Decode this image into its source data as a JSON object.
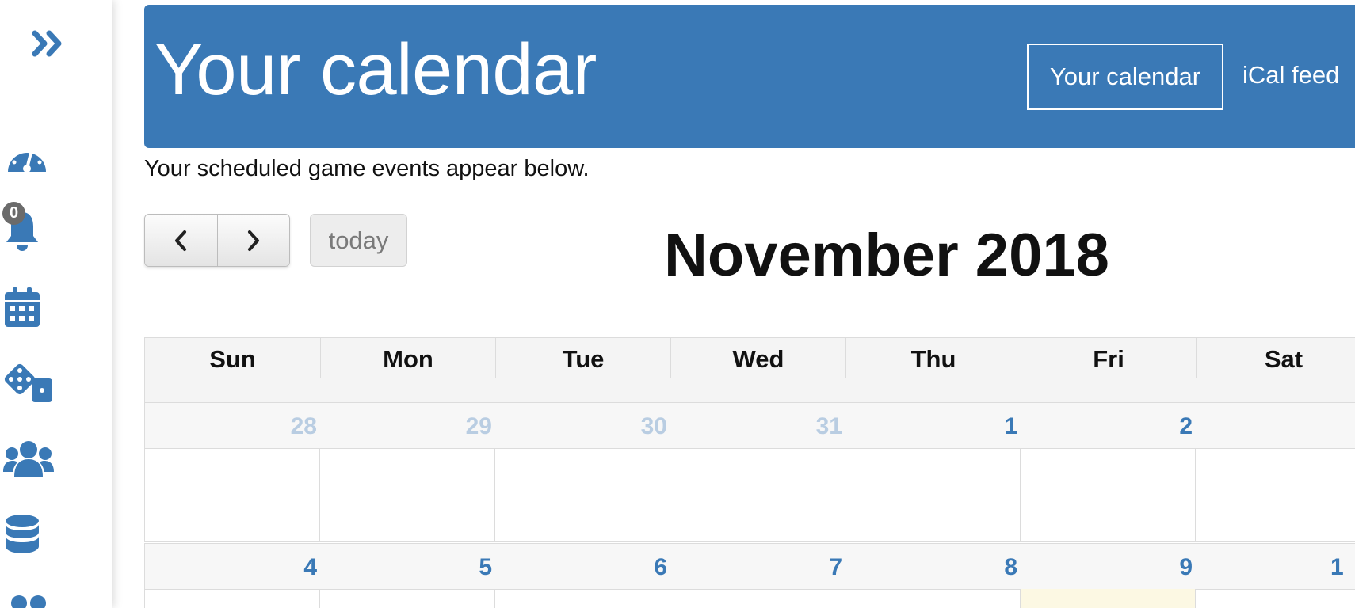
{
  "sidebar": {
    "icons": [
      "double-chevron-right-icon",
      "dashboard-gauge-icon",
      "bell-icon",
      "calendar-icon",
      "dice-icon",
      "users-group-icon",
      "database-icon",
      "users-icon"
    ],
    "notification_count": "0"
  },
  "header": {
    "title": "Your calendar",
    "nav": {
      "active_label": "Your calendar",
      "ical_label": "iCal feed"
    }
  },
  "subtitle": "Your scheduled game events appear below.",
  "toolbar": {
    "today_label": "today",
    "month_title": "November 2018"
  },
  "calendar": {
    "weekdays": [
      "Sun",
      "Mon",
      "Tue",
      "Wed",
      "Thu",
      "Fri",
      "Sat"
    ],
    "weeks": [
      [
        "28",
        "29",
        "30",
        "31",
        "1",
        "2",
        ""
      ],
      [
        "4",
        "5",
        "6",
        "7",
        "8",
        "9",
        "1"
      ]
    ]
  },
  "colors": {
    "accent": "#3a79b6",
    "muted_day": "#b9cde2",
    "today_highlight": "#fcf8e3"
  }
}
